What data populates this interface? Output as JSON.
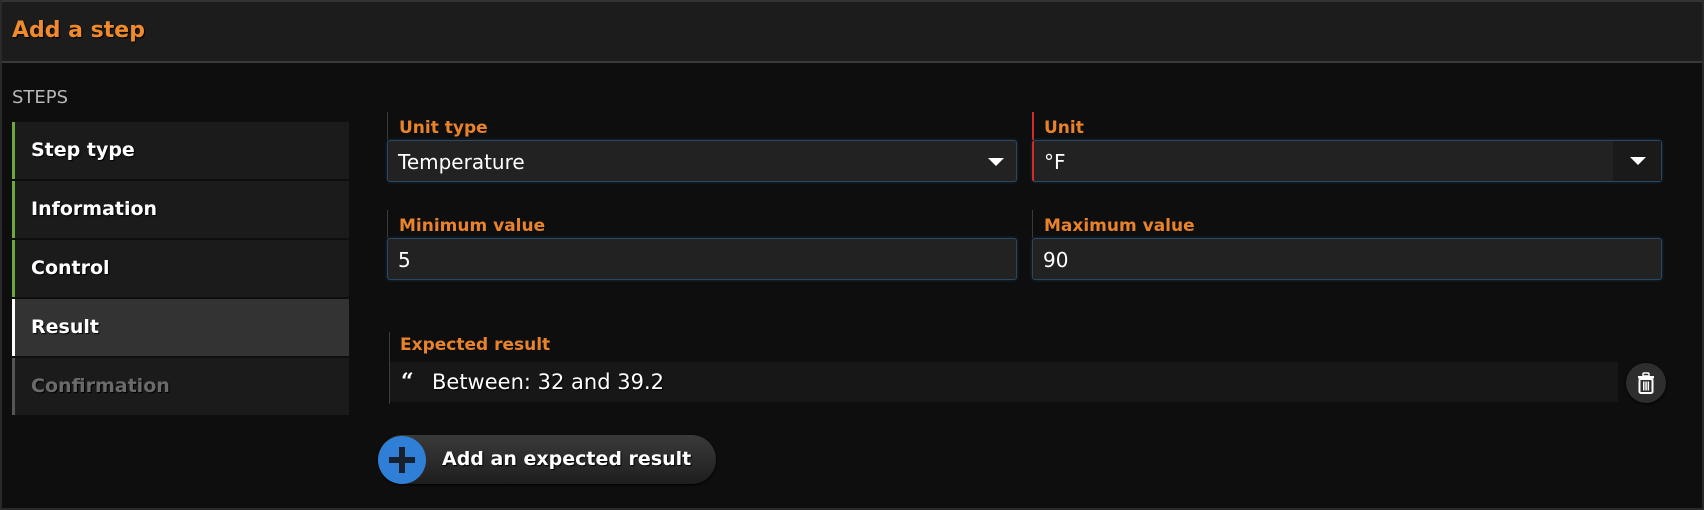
{
  "header": {
    "title": "Add a step"
  },
  "sidebar": {
    "section_label": "STEPS",
    "items": [
      {
        "label": "Step type",
        "state": "done"
      },
      {
        "label": "Information",
        "state": "done"
      },
      {
        "label": "Control",
        "state": "done"
      },
      {
        "label": "Result",
        "state": "active"
      },
      {
        "label": "Confirmation",
        "state": "disabled"
      }
    ]
  },
  "form": {
    "unit_type": {
      "label": "Unit type",
      "value": "Temperature"
    },
    "unit": {
      "label": "Unit",
      "value": "°F",
      "invalid": true
    },
    "minimum": {
      "label": "Minimum value",
      "value": "5"
    },
    "maximum": {
      "label": "Maximum value",
      "value": "90"
    },
    "expected": {
      "label": "Expected result",
      "items": [
        {
          "text": "Between: 32 and 39.2",
          "icon": "quote-icon"
        }
      ]
    },
    "add_button_label": "Add an expected result"
  },
  "colors": {
    "accent_orange": "#f08a2c",
    "done_green": "#6aa83a",
    "invalid_red": "#d42a2a",
    "add_blue": "#2f7fd6"
  }
}
